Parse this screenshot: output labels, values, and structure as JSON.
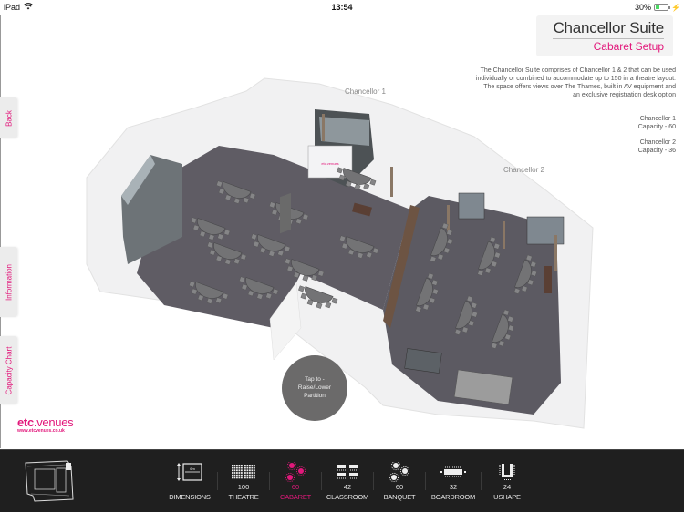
{
  "status_bar": {
    "device": "iPad",
    "time": "13:54",
    "battery_percent_label": "30%",
    "battery_level": 0.3
  },
  "header": {
    "title": "Chancellor Suite",
    "subtitle": "Cabaret Setup"
  },
  "description": {
    "paragraph1": "The Chancellor Suite comprises of Chancellor 1 & 2 that can be used individually or combined to accommodate up to 150 in a theatre layout.",
    "paragraph2": "The space offers views over The Thames, built in AV equipment and an exclusive registration desk option"
  },
  "rooms": [
    {
      "name": "Chancellor 1",
      "capacity_label": "Capacity - 60"
    },
    {
      "name": "Chancellor 2",
      "capacity_label": "Capacity - 36"
    }
  ],
  "floorplan": {
    "room1_label": "Chancellor 1",
    "room2_label": "Chancellor 2",
    "screen_brand": "etc.venues",
    "partition_button": {
      "line1": "Tap to -",
      "line2": "Raise/Lower",
      "line3": "Partition"
    }
  },
  "side_tabs": [
    {
      "label": "Back"
    },
    {
      "label": "Information"
    },
    {
      "label": "Capacity Chart"
    }
  ],
  "logo": {
    "brand_part1": "etc",
    "brand_part2": ".venues",
    "url": "www.etcvenues.co.uk"
  },
  "bottom_bar": {
    "setups": [
      {
        "icon": "dimensions-icon",
        "count": "",
        "label": "DIMENSIONS",
        "active": false
      },
      {
        "icon": "theatre-icon",
        "count": "100",
        "label": "THEATRE",
        "active": false
      },
      {
        "icon": "cabaret-icon",
        "count": "60",
        "label": "CABARET",
        "active": true
      },
      {
        "icon": "classroom-icon",
        "count": "42",
        "label": "CLASSROOM",
        "active": false
      },
      {
        "icon": "banquet-icon",
        "count": "60",
        "label": "BANQUET",
        "active": false
      },
      {
        "icon": "boardroom-icon",
        "count": "32",
        "label": "BOARDROOM",
        "active": false
      },
      {
        "icon": "ushape-icon",
        "count": "24",
        "label": "USHAPE",
        "active": false
      }
    ],
    "dimensions_icon_text": "6m"
  },
  "colors": {
    "accent": "#e2187b",
    "bottom_bar_bg": "#1f1f1f",
    "button_bg": "#6b6a6a",
    "floor": "#5f5c64",
    "table": "#6e6e70",
    "wall": "#f4f4f4"
  }
}
